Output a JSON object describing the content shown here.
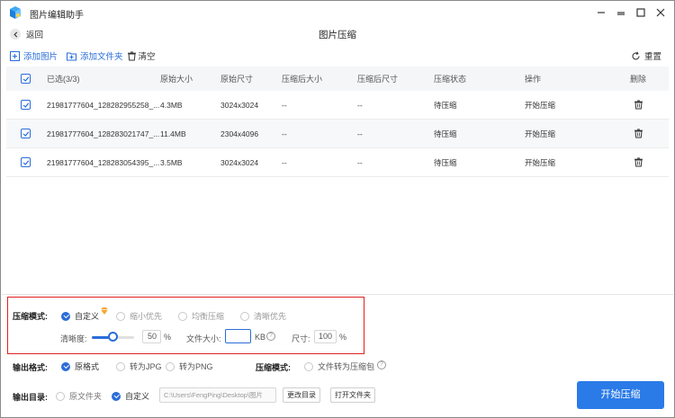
{
  "app": {
    "title": "图片编辑助手"
  },
  "nav": {
    "back_label": "返回",
    "page_title": "图片压缩"
  },
  "toolbar": {
    "add_image": "添加图片",
    "add_folder": "添加文件夹",
    "clear": "清空",
    "reset": "重置"
  },
  "table": {
    "headers": {
      "selected": "已选(3/3)",
      "orig_size": "原始大小",
      "orig_dim": "原始尺寸",
      "comp_size": "压缩后大小",
      "comp_dim": "压缩后尺寸",
      "status": "压缩状态",
      "action": "操作",
      "delete": "删除"
    },
    "rows": [
      {
        "name": "21981777604_128282955258_...",
        "size": "4.3MB",
        "dim": "3024x3024",
        "comp_size": "--",
        "comp_dim": "--",
        "status": "待压缩",
        "action": "开始压缩"
      },
      {
        "name": "21981777604_128283021747_...",
        "size": "11.4MB",
        "dim": "2304x4096",
        "comp_size": "--",
        "comp_dim": "--",
        "status": "待压缩",
        "action": "开始压缩"
      },
      {
        "name": "21981777604_128283054395_...",
        "size": "3.5MB",
        "dim": "3024x3024",
        "comp_size": "--",
        "comp_dim": "--",
        "status": "待压缩",
        "action": "开始压缩"
      }
    ]
  },
  "compression": {
    "mode_label": "压缩模式:",
    "modes": [
      "自定义",
      "缩小优先",
      "均衡压缩",
      "清晰优先"
    ],
    "selected_mode": 0,
    "clarity_label": "清晰度:",
    "clarity_value": "50",
    "clarity_percent": 50,
    "percent_unit": "%",
    "filesize_label": "文件大小:",
    "filesize_value": "",
    "filesize_unit": "KB",
    "dimension_label": "尺寸:",
    "dimension_value": "100",
    "dimension_unit": "%"
  },
  "output": {
    "format_label": "输出格式:",
    "formats": [
      "原格式",
      "转为JPG",
      "转为PNG"
    ],
    "selected_format": 0,
    "compress_mode_label": "压缩模式:",
    "to_zip_label": "文件转为压缩包",
    "dir_label": "输出目录:",
    "dirs": [
      "原文件夹",
      "自定义"
    ],
    "selected_dir": 1,
    "path": "C:\\Users\\FengPing\\Desktop\\图片",
    "change_dir": "更改目录",
    "open_folder": "打开文件夹",
    "start": "开始压缩"
  },
  "colors": {
    "accent": "#2a7ae8",
    "highlight_box": "#e02020"
  }
}
